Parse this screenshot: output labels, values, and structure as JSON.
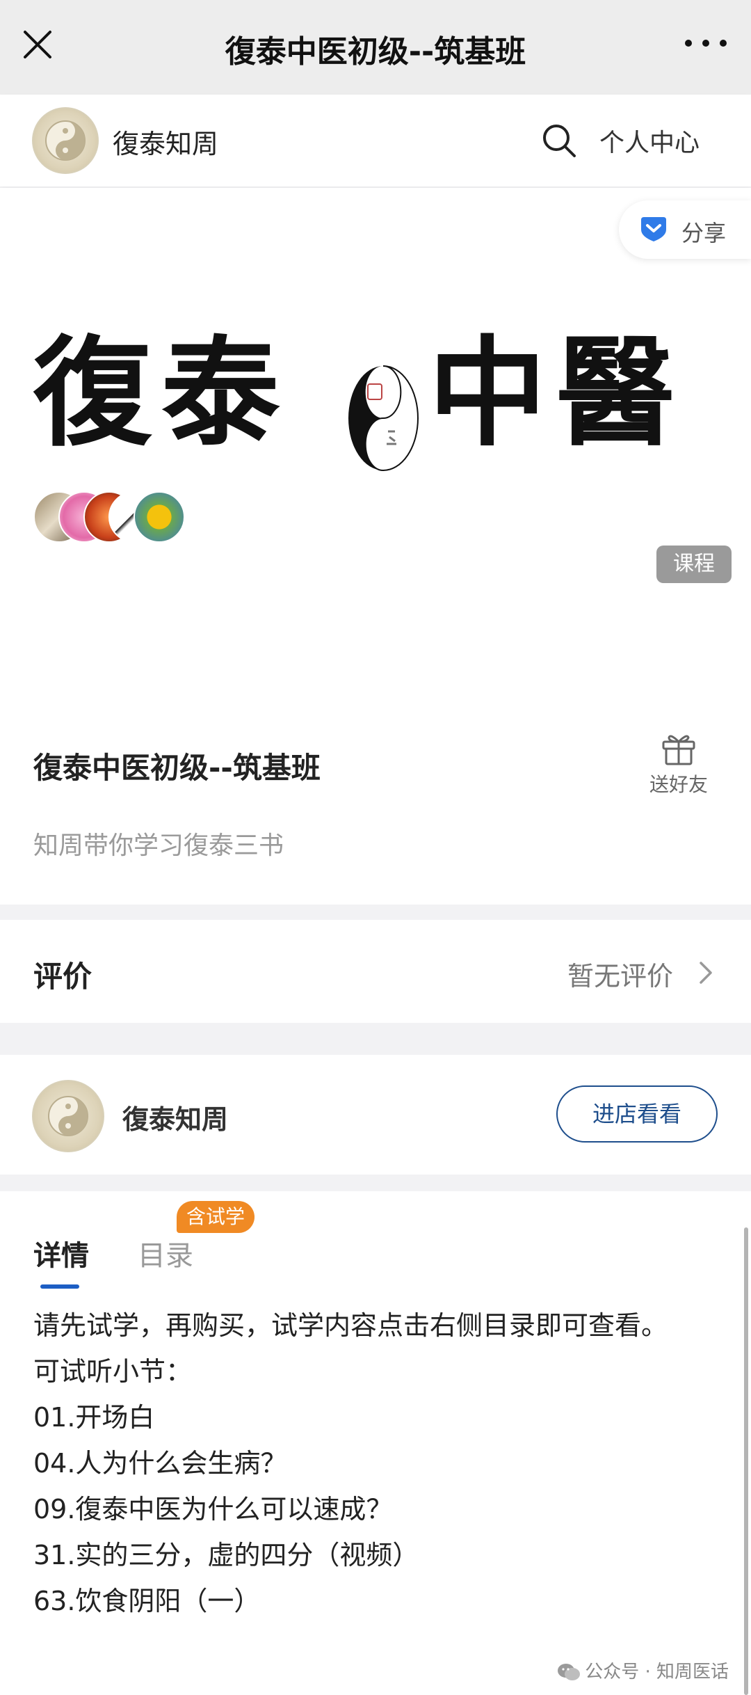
{
  "nav": {
    "title": "復泰中医初级--筑基班",
    "close_icon": "close-icon",
    "more_icon": "more-icon"
  },
  "shop_header": {
    "name": "復泰知周",
    "search_icon": "search-icon",
    "personal_center": "个人中心"
  },
  "hero": {
    "share_label": "分享",
    "calligraphy": [
      "復",
      "泰",
      "中",
      "醫"
    ],
    "course_badge": "课程"
  },
  "course": {
    "title": "復泰中医初级--筑基班",
    "gift_label": "送好友",
    "subtitle": "知周带你学习復泰三书"
  },
  "review": {
    "label": "评价",
    "status": "暂无评价"
  },
  "shop_card": {
    "name": "復泰知周",
    "enter_button": "进店看看"
  },
  "tabs": {
    "details": "详情",
    "catalog": "目录",
    "trial_badge": "含试学"
  },
  "content": {
    "lines": [
      "请先试学，再购买，试学内容点击右侧目录即可查看。",
      "可试听小节：",
      "01.开场白",
      "04.人为什么会生病？",
      "09.復泰中医为什么可以速成？",
      "31.实的三分，虚的四分（视频）",
      "63.饮食阴阳（一）"
    ]
  },
  "watermark": "公众号 · 知周医话",
  "colors": {
    "accent_blue": "#1e4e8c",
    "tab_underline": "#1d5ec4",
    "trial_badge": "#f08a24"
  }
}
